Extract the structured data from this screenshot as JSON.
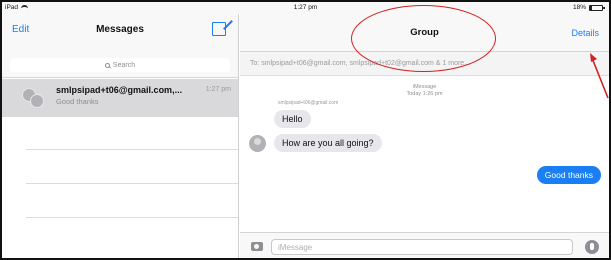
{
  "status_bar": {
    "device": "iPad",
    "time": "1:27 pm",
    "battery": "18%"
  },
  "left_nav": {
    "edit_label": "Edit",
    "title": "Messages"
  },
  "search": {
    "placeholder": "Search"
  },
  "conversations": [
    {
      "name": "smlpsipad+t06@gmail.com,...",
      "time": "1:27 pm",
      "preview": "Good thanks"
    }
  ],
  "right_nav": {
    "title": "Group",
    "details_label": "Details"
  },
  "to_bar": {
    "text": "To: smlpsipad+t06@gmail.com, smlpsipad+t02@gmail.com & 1 more..."
  },
  "thread": {
    "service_label": "iMessage",
    "date_label": "Today 1:26 pm",
    "sender": "smlpsipad+t06@gmail.com",
    "messages": [
      {
        "direction": "incoming",
        "text": "Hello"
      },
      {
        "direction": "incoming",
        "text": "How are you all going?"
      },
      {
        "direction": "outgoing",
        "text": "Good thanks"
      }
    ]
  },
  "composer": {
    "placeholder": "iMessage"
  },
  "colors": {
    "accent": "#1a7ef5",
    "annotation": "#d42020",
    "bubble_in": "#e6e6eb"
  }
}
